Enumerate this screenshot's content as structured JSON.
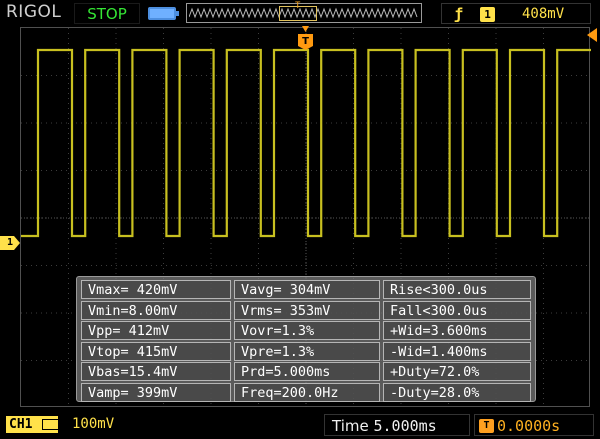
{
  "top": {
    "brand": "RIGOL",
    "run_state": "STOP",
    "trigger_channel": "1",
    "trigger_level": "408mV",
    "memory_trigger_icon": "T"
  },
  "channel_marker": "1",
  "trigger_position_marker": "T",
  "measurements": [
    [
      "Vmax= 420mV",
      "Vavg= 304mV",
      "Rise<300.0us"
    ],
    [
      "Vmin=8.00mV",
      "Vrms= 353mV",
      "Fall<300.0us"
    ],
    [
      "Vpp= 412mV",
      "Vovr=1.3%",
      "+Wid=3.600ms"
    ],
    [
      "Vtop= 415mV",
      "Vpre=1.3%",
      "-Wid=1.400ms"
    ],
    [
      "Vbas=15.4mV",
      "Prd=5.000ms",
      "+Duty=72.0%"
    ],
    [
      "Vamp= 399mV",
      "Freq=200.0Hz",
      "-Duty=28.0%"
    ]
  ],
  "bottom": {
    "ch_label": "CH1",
    "ch_scale": "100mV",
    "time_label": "Time",
    "time_value": "5.000ms",
    "offset_icon": "T",
    "offset_value": "0.0000s"
  },
  "icons": {
    "battery": "battery-icon",
    "edge": "rising-edge-icon",
    "trigger_marker": "trigger-position-icon"
  },
  "colors": {
    "trace": "#c8c020",
    "accent_yellow": "#ffe14a",
    "stop_green": "#35e635",
    "offset_orange": "#ffa020",
    "grid": "#505050"
  }
}
